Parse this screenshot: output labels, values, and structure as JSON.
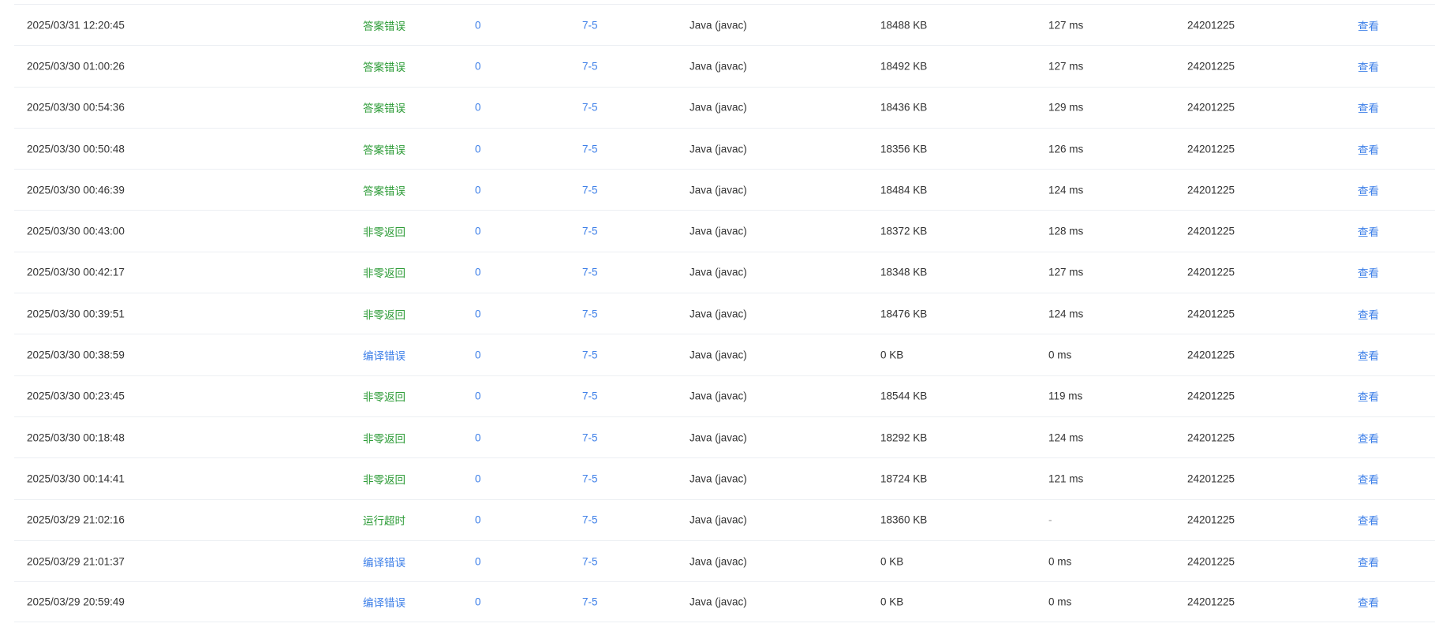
{
  "colors": {
    "wrong_answer": "#2e9c38",
    "compile_error": "#3d7fe8",
    "link": "#3d7fe8",
    "text": "#333333"
  },
  "rows": [
    {
      "time": "2025/03/31 12:20:45",
      "status": "答案错误",
      "status_color": "green",
      "score": "0",
      "problem": "7-5",
      "lang": "Java (javac)",
      "memory": "18488 KB",
      "runtime": "127 ms",
      "user": "24201225",
      "action": "查看"
    },
    {
      "time": "2025/03/30 01:00:26",
      "status": "答案错误",
      "status_color": "green",
      "score": "0",
      "problem": "7-5",
      "lang": "Java (javac)",
      "memory": "18492 KB",
      "runtime": "127 ms",
      "user": "24201225",
      "action": "查看"
    },
    {
      "time": "2025/03/30 00:54:36",
      "status": "答案错误",
      "status_color": "green",
      "score": "0",
      "problem": "7-5",
      "lang": "Java (javac)",
      "memory": "18436 KB",
      "runtime": "129 ms",
      "user": "24201225",
      "action": "查看"
    },
    {
      "time": "2025/03/30 00:50:48",
      "status": "答案错误",
      "status_color": "green",
      "score": "0",
      "problem": "7-5",
      "lang": "Java (javac)",
      "memory": "18356 KB",
      "runtime": "126 ms",
      "user": "24201225",
      "action": "查看"
    },
    {
      "time": "2025/03/30 00:46:39",
      "status": "答案错误",
      "status_color": "green",
      "score": "0",
      "problem": "7-5",
      "lang": "Java (javac)",
      "memory": "18484 KB",
      "runtime": "124 ms",
      "user": "24201225",
      "action": "查看"
    },
    {
      "time": "2025/03/30 00:43:00",
      "status": "非零返回",
      "status_color": "green",
      "score": "0",
      "problem": "7-5",
      "lang": "Java (javac)",
      "memory": "18372 KB",
      "runtime": "128 ms",
      "user": "24201225",
      "action": "查看"
    },
    {
      "time": "2025/03/30 00:42:17",
      "status": "非零返回",
      "status_color": "green",
      "score": "0",
      "problem": "7-5",
      "lang": "Java (javac)",
      "memory": "18348 KB",
      "runtime": "127 ms",
      "user": "24201225",
      "action": "查看"
    },
    {
      "time": "2025/03/30 00:39:51",
      "status": "非零返回",
      "status_color": "green",
      "score": "0",
      "problem": "7-5",
      "lang": "Java (javac)",
      "memory": "18476 KB",
      "runtime": "124 ms",
      "user": "24201225",
      "action": "查看"
    },
    {
      "time": "2025/03/30 00:38:59",
      "status": "编译错误",
      "status_color": "blue",
      "score": "0",
      "problem": "7-5",
      "lang": "Java (javac)",
      "memory": "0 KB",
      "runtime": "0 ms",
      "user": "24201225",
      "action": "查看"
    },
    {
      "time": "2025/03/30 00:23:45",
      "status": "非零返回",
      "status_color": "green",
      "score": "0",
      "problem": "7-5",
      "lang": "Java (javac)",
      "memory": "18544 KB",
      "runtime": "119 ms",
      "user": "24201225",
      "action": "查看"
    },
    {
      "time": "2025/03/30 00:18:48",
      "status": "非零返回",
      "status_color": "green",
      "score": "0",
      "problem": "7-5",
      "lang": "Java (javac)",
      "memory": "18292 KB",
      "runtime": "124 ms",
      "user": "24201225",
      "action": "查看"
    },
    {
      "time": "2025/03/30 00:14:41",
      "status": "非零返回",
      "status_color": "green",
      "score": "0",
      "problem": "7-5",
      "lang": "Java (javac)",
      "memory": "18724 KB",
      "runtime": "121 ms",
      "user": "24201225",
      "action": "查看"
    },
    {
      "time": "2025/03/29 21:02:16",
      "status": "运行超时",
      "status_color": "green",
      "score": "0",
      "problem": "7-5",
      "lang": "Java (javac)",
      "memory": "18360 KB",
      "runtime": "-",
      "user": "24201225",
      "action": "查看"
    },
    {
      "time": "2025/03/29 21:01:37",
      "status": "编译错误",
      "status_color": "blue",
      "score": "0",
      "problem": "7-5",
      "lang": "Java (javac)",
      "memory": "0 KB",
      "runtime": "0 ms",
      "user": "24201225",
      "action": "查看"
    },
    {
      "time": "2025/03/29 20:59:49",
      "status": "编译错误",
      "status_color": "blue",
      "score": "0",
      "problem": "7-5",
      "lang": "Java (javac)",
      "memory": "0 KB",
      "runtime": "0 ms",
      "user": "24201225",
      "action": "查看"
    }
  ]
}
